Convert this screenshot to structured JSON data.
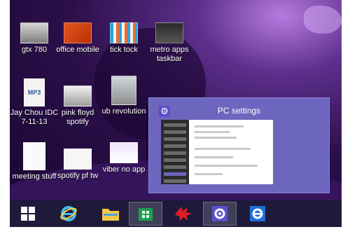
{
  "desktop_icons": [
    {
      "label": "gtx 780"
    },
    {
      "label": "office mobile"
    },
    {
      "label": "tick tock"
    },
    {
      "label": "metro apps\ntaskbar"
    },
    {
      "label": "Jay Chou IDC\n7-11-13",
      "badge": "MP3"
    },
    {
      "label": "pink floyd\nspotify"
    },
    {
      "label": "ub revolution"
    },
    {
      "label": "meeting stuff"
    },
    {
      "label": "spotify pf tw"
    },
    {
      "label": "viber no app"
    }
  ],
  "preview": {
    "title": "PC settings",
    "icon": "gear-icon"
  },
  "taskbar": {
    "items": [
      {
        "name": "start-button",
        "icon": "windows-logo-icon"
      },
      {
        "name": "internet-explorer-button",
        "icon": "ie-icon"
      },
      {
        "name": "file-explorer-button",
        "icon": "folder-icon"
      },
      {
        "name": "store-button",
        "icon": "store-icon"
      },
      {
        "name": "red-app-button",
        "icon": "red-splat-icon"
      },
      {
        "name": "pc-settings-button",
        "icon": "gear-icon"
      },
      {
        "name": "ie-metro-button",
        "icon": "ie-icon"
      }
    ]
  }
}
